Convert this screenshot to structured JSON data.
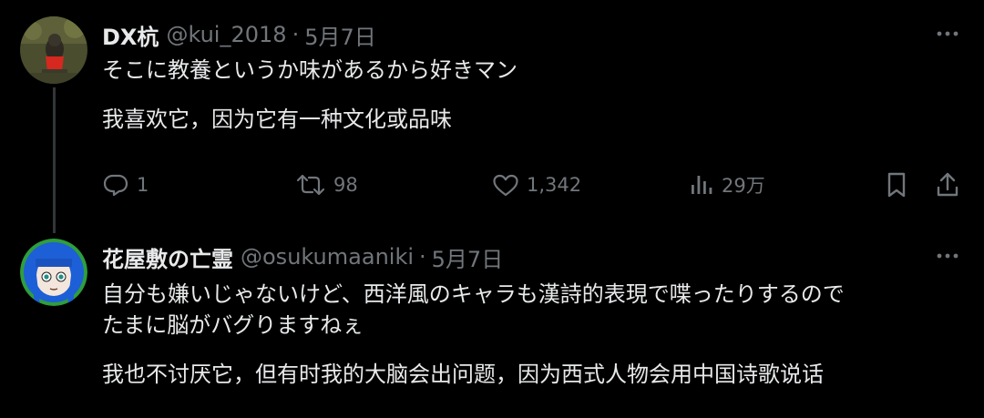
{
  "tweet1": {
    "display_name": "DX杭",
    "handle": "@kui_2018",
    "separator": "·",
    "date": "5月7日",
    "text_original": "そこに教養というか味があるから好きマン",
    "text_translation": "我喜欢它，因为它有一种文化或品味",
    "actions": {
      "reply_count": "1",
      "retweet_count": "98",
      "like_count": "1,342",
      "view_count": "29万"
    }
  },
  "tweet2": {
    "display_name": "花屋敷の亡霊",
    "handle": "@osukumaaniki",
    "separator": "·",
    "date": "5月7日",
    "text_original_line1": "自分も嫌いじゃないけど、西洋風のキャラも漢詩的表現で喋ったりするので",
    "text_original_line2": "たまに脳がバグりますねぇ",
    "text_translation": "我也不讨厌它，但有时我的大脑会出问题，因为西式人物会用中国诗歌说话"
  },
  "icons": {
    "more": "more-icon",
    "reply": "reply-icon",
    "retweet": "retweet-icon",
    "like": "like-icon",
    "views": "views-icon",
    "bookmark": "bookmark-icon",
    "share": "share-icon"
  },
  "colors": {
    "background": "#000000",
    "primary_text": "#e7e9ea",
    "secondary_text": "#71767b",
    "thread_line": "#333639",
    "avatar2_ring": "#2f9e3d",
    "avatar2_hair": "#1d5fd6"
  }
}
